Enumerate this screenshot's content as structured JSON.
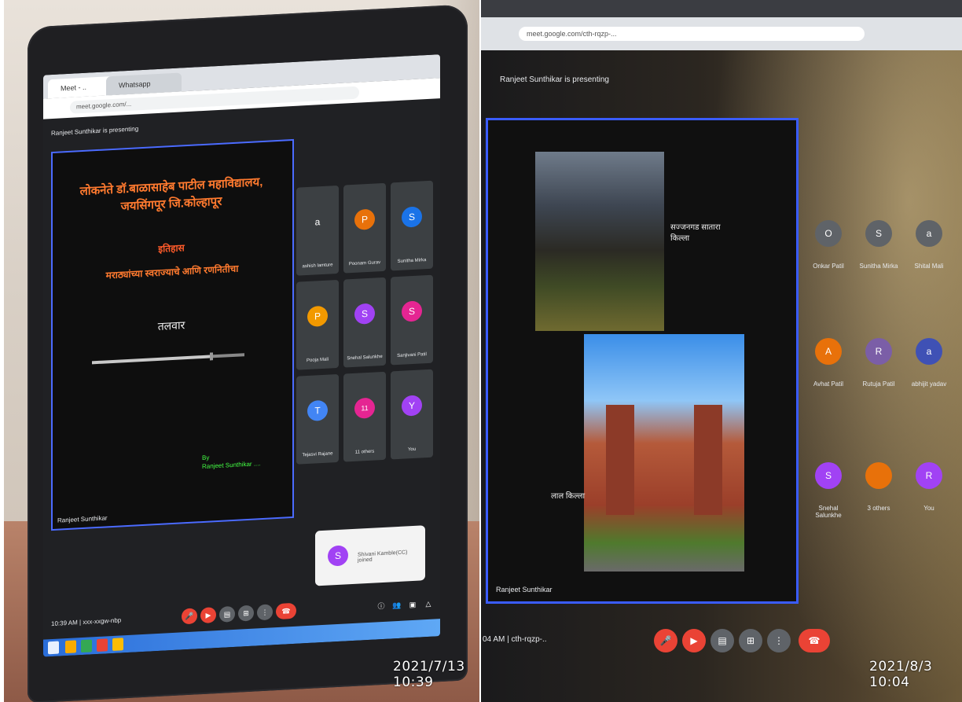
{
  "left_photo": {
    "browser": {
      "tab_active_label": "Meet - ..",
      "tab_second_label": "Whatsapp",
      "address": "meet.google.com/..."
    },
    "meet": {
      "presenting_label": "Ranjeet Sunthikar is presenting",
      "slide": {
        "title_lines": [
          "लोकनेते डॉ.बाळासाहेब पाटील महाविद्यालय,",
          "जयसिंगपूर जि.कोल्हापूर"
        ],
        "subject": "इतिहास",
        "line": "मराठ्यांच्या स्वराज्याचे आणि रणनितीचा",
        "word": "तलवार",
        "footer_green": [
          "By",
          "Ranjeet Sunthikar ...."
        ]
      },
      "presenter_caption": "Ranjeet Sunthikar",
      "tiles": [
        {
          "initial": "a",
          "name": "ashish lamture",
          "color": "#3c4043"
        },
        {
          "initial": "P",
          "name": "Poonam Gurav",
          "color": "#e8710a"
        },
        {
          "initial": "S",
          "name": "Sunitha Mirka",
          "color": "#1a73e8"
        },
        {
          "initial": "P",
          "name": "Pooja Mali",
          "color": "#f29900"
        },
        {
          "initial": "S",
          "name": "Snehal Salunkhe",
          "color": "#a142f4"
        },
        {
          "initial": "S",
          "name": "Sanjivani Patil",
          "color": "#e52592"
        },
        {
          "initial": "T",
          "name": "Tejasvi Rajane",
          "color": "#4285f4"
        },
        {
          "initial": "11",
          "name": "11 others",
          "color": "#3c4043"
        },
        {
          "initial": "Y",
          "name": "You",
          "color": "#a142f4"
        }
      ],
      "toast": {
        "initial": "S",
        "message": "Shivani Kamble(CC) joined"
      },
      "meeting_time": "10:39 AM | xxx-xxgw-nbp",
      "controls": [
        "mic-off",
        "cam-off",
        "cc",
        "present",
        "more",
        "end-call"
      ]
    },
    "timestamp": "2021/7/13  10:39",
    "colors": {
      "present_border": "#4b6bff",
      "end_call": "#ea4335",
      "muted": "#ea4335"
    }
  },
  "right_photo": {
    "browser": {
      "address": "meet.google.com/cth-rqzp-..."
    },
    "presenting_label": "Ranjeet Sunthikar is presenting",
    "slide": {
      "fort1_label_lines": [
        "सज्जनगड सातारा",
        "किल्ला"
      ],
      "fort2_label": "लाल किल्ला"
    },
    "presenter_caption": "Ranjeet Sunthikar",
    "tiles": [
      {
        "initial": "O",
        "name": "Onkar Patil",
        "color": "#5f6368"
      },
      {
        "initial": "S",
        "name": "Sunitha Mirka",
        "color": "#5f6368"
      },
      {
        "initial": "a",
        "name": "Shital Mali",
        "color": "#5f6368"
      },
      {
        "initial": "A",
        "name": "Avhat Patil",
        "color": "#e8710a"
      },
      {
        "initial": "R",
        "name": "Rutuja Patil",
        "color": "#7b5ea7"
      },
      {
        "initial": "a",
        "name": "abhijit yadav",
        "color": "#3f51b5"
      },
      {
        "initial": "S",
        "name": "Snehal Salunkhe",
        "color": "#a142f4"
      },
      {
        "initial": "",
        "name": "3 others",
        "color": "#e8710a"
      },
      {
        "initial": "R",
        "name": "You",
        "color": "#a142f4"
      }
    ],
    "meeting_time": "04 AM | cth-rqzp-..",
    "timestamp": "2021/8/3  10:04"
  }
}
